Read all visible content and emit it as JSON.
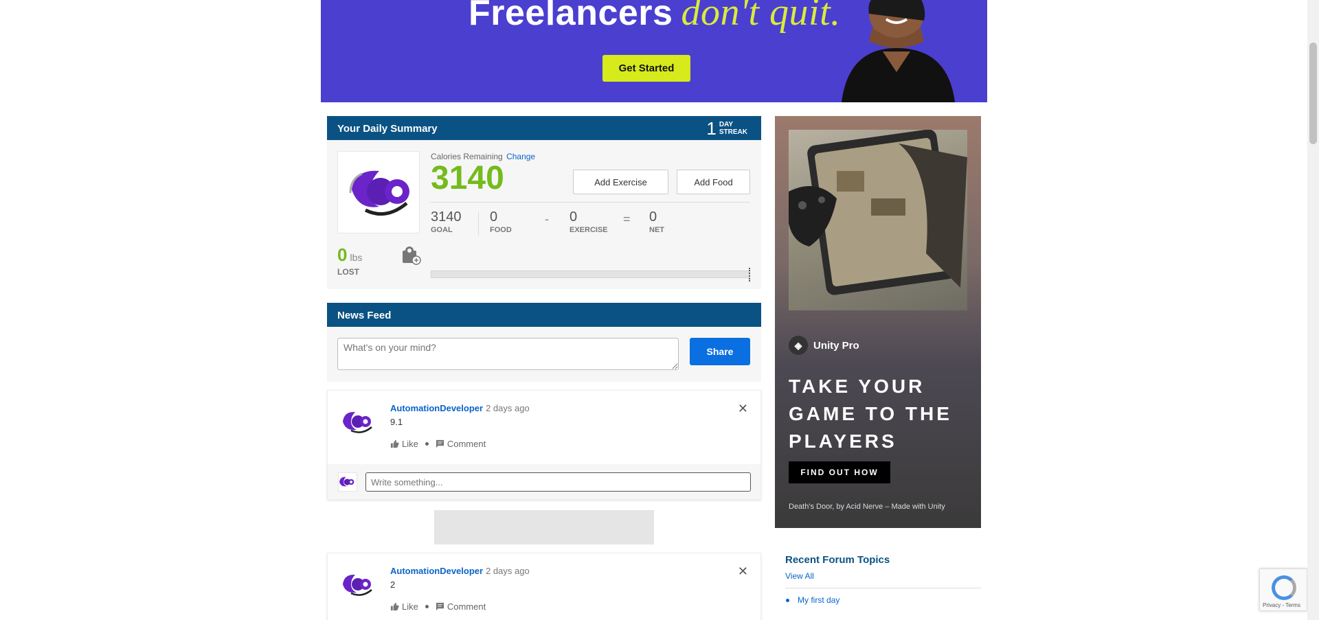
{
  "banner": {
    "headline": "Freelancers",
    "headline_accent": "don't quit.",
    "cta": "Get Started"
  },
  "summary": {
    "title": "Your Daily Summary",
    "streak_count": "1",
    "streak_line1": "DAY",
    "streak_line2": "STREAK",
    "calories_label": "Calories Remaining",
    "change_link": "Change",
    "calories_remaining": "3140",
    "add_exercise": "Add Exercise",
    "add_food": "Add Food",
    "goal_value": "3140",
    "goal_label": "GOAL",
    "food_value": "0",
    "food_label": "FOOD",
    "minus": "-",
    "exercise_value": "0",
    "exercise_label": "EXERCISE",
    "equals": "=",
    "net_value": "0",
    "net_label": "NET",
    "lbs_value": "0",
    "lbs_unit": "lbs",
    "lost_label": "LOST",
    "badge": "0",
    "progress": 0
  },
  "feed": {
    "title": "News Feed",
    "placeholder": "What's on your mind?",
    "share": "Share",
    "posts": [
      {
        "user": "AutomationDeveloper",
        "time": "2 days ago",
        "content": "9.1",
        "like": "Like",
        "comment": "Comment",
        "close": "✕",
        "comment_placeholder": "Write something..."
      },
      {
        "user": "AutomationDeveloper",
        "time": "2 days ago",
        "content": "2",
        "like": "Like",
        "comment": "Comment",
        "close": "✕"
      }
    ]
  },
  "side_ad": {
    "brand": "Unity Pro",
    "tagline": "TAKE YOUR GAME TO THE PLAYERS",
    "cta": "FIND OUT HOW",
    "credit": "Death's Door, by Acid Nerve – Made with Unity"
  },
  "forum": {
    "title": "Recent Forum Topics",
    "view_all": "View All",
    "topics": [
      "My first day"
    ]
  },
  "recaptcha": {
    "text": "Privacy - Terms"
  },
  "colors": {
    "header_blue": "#0a5283",
    "accent_green": "#74bb1c",
    "link_blue": "#0a63c9",
    "share_blue": "#0a6fe0"
  }
}
